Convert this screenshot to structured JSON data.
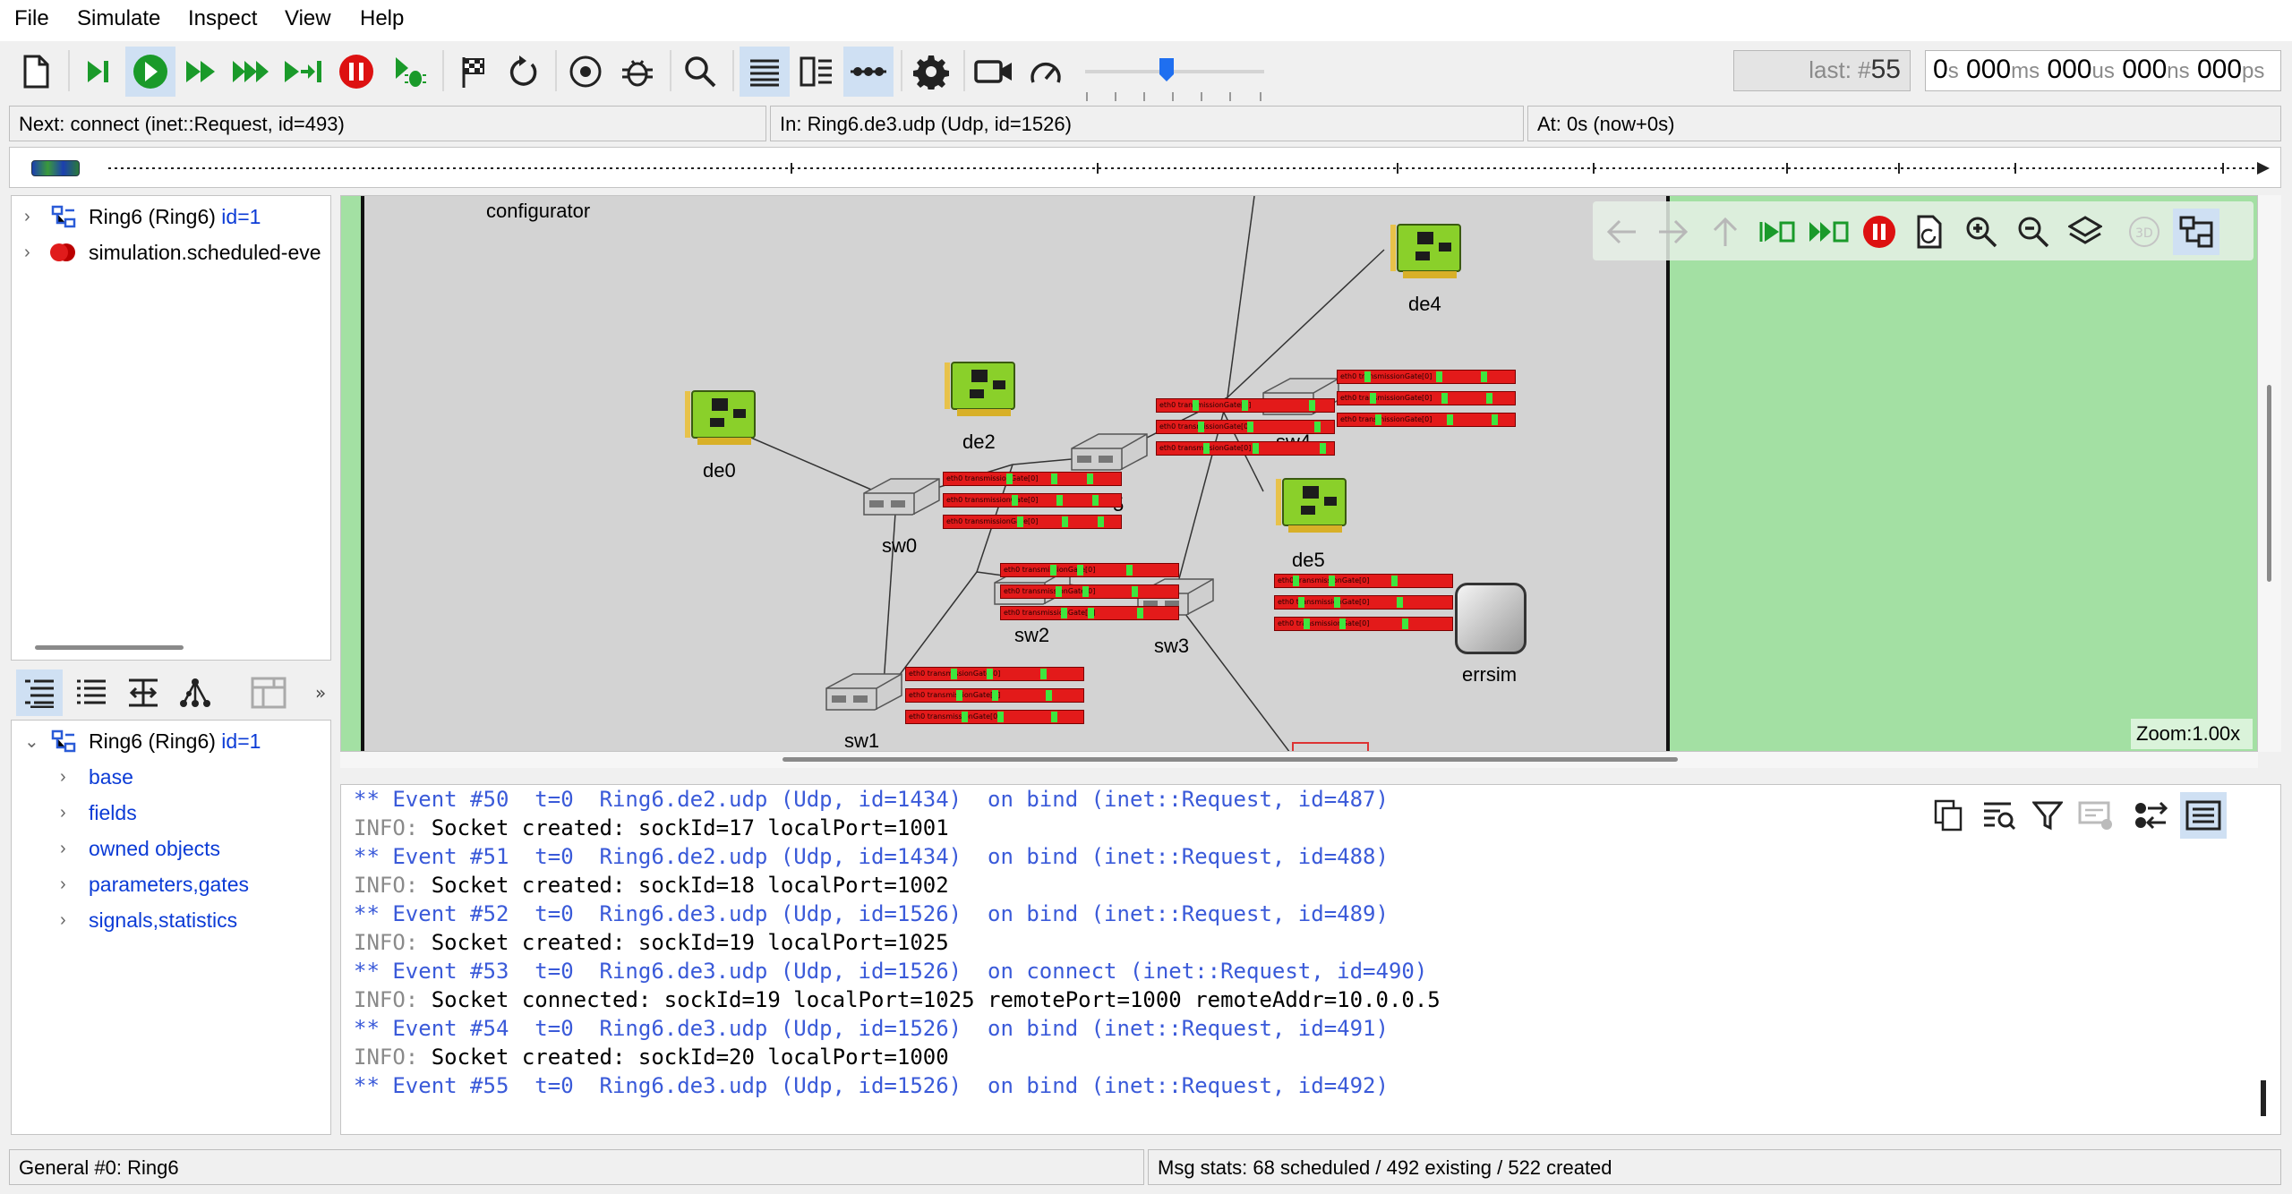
{
  "menu": [
    "File",
    "Simulate",
    "Inspect",
    "View",
    "Help"
  ],
  "toolbar": {
    "buttons": [
      "new-network",
      "step",
      "run",
      "fast-run",
      "express-run",
      "run-until",
      "stop",
      "debug-next-event",
      "set-cutoff",
      "rebuild-network",
      "record-video",
      "speed"
    ],
    "last_event_prefix": "last: #",
    "last_event": "55",
    "simtime": {
      "s": "0",
      "s_u": "s",
      "ms": "000",
      "ms_u": "ms",
      "us": "000",
      "us_u": "us",
      "ns": "000",
      "ns_u": "ns",
      "ps": "000",
      "ps_u": "ps"
    },
    "speed_level": 0.45
  },
  "status": {
    "next": "Next: connect (inet::Request, id=493)",
    "in": "In: Ring6.de3.udp (Udp, id=1526)",
    "at": "At: 0s (now+0s)"
  },
  "object_tree": [
    {
      "name": "Ring6 (Ring6)",
      "id": "id=1",
      "icon": "network-icon"
    },
    {
      "name": "simulation.scheduled-eve",
      "id": "",
      "icon": "event-queue-icon"
    }
  ],
  "inspector_tabs": [
    "grouped-view",
    "flat-view",
    "inheritance-view",
    "children-view",
    "layout-view"
  ],
  "props_tree": {
    "root": {
      "name": "Ring6 (Ring6)",
      "id": "id=1"
    },
    "children": [
      "base",
      "fields",
      "owned objects",
      "parameters,gates",
      "signals,statistics"
    ]
  },
  "canvas": {
    "configurator": "configurator",
    "nodes": {
      "de0": "de0",
      "de2": "de2",
      "de4": "de4",
      "de5": "de5",
      "sw0": "sw0",
      "sw1": "sw1",
      "sw2": "sw2",
      "sw3": "sw3",
      "sw4": "sw4",
      "sw5": "5",
      "errsim": "errsim"
    },
    "queue_label": "eth0 transmissionGate[0]",
    "zoom": "Zoom:1.00x"
  },
  "log": [
    {
      "type": "event",
      "text": "** Event #50  t=0  Ring6.de2.udp (Udp, id=1434)  on bind (inet::Request, id=487)"
    },
    {
      "type": "info",
      "prefix": "INFO: ",
      "text": "Socket created: sockId=17 localPort=1001"
    },
    {
      "type": "event",
      "text": "** Event #51  t=0  Ring6.de2.udp (Udp, id=1434)  on bind (inet::Request, id=488)"
    },
    {
      "type": "info",
      "prefix": "INFO: ",
      "text": "Socket created: sockId=18 localPort=1002"
    },
    {
      "type": "event",
      "text": "** Event #52  t=0  Ring6.de3.udp (Udp, id=1526)  on bind (inet::Request, id=489)"
    },
    {
      "type": "info",
      "prefix": "INFO: ",
      "text": "Socket created: sockId=19 localPort=1025"
    },
    {
      "type": "event",
      "text": "** Event #53  t=0  Ring6.de3.udp (Udp, id=1526)  on connect (inet::Request, id=490)"
    },
    {
      "type": "info",
      "prefix": "INFO: ",
      "text": "Socket connected: sockId=19 localPort=1025 remotePort=1000 remoteAddr=10.0.0.5"
    },
    {
      "type": "event",
      "text": "** Event #54  t=0  Ring6.de3.udp (Udp, id=1526)  on bind (inet::Request, id=491)"
    },
    {
      "type": "info",
      "prefix": "INFO: ",
      "text": "Socket created: sockId=20 localPort=1000"
    },
    {
      "type": "event",
      "text": "** Event #55  t=0  Ring6.de3.udp (Udp, id=1526)  on bind (inet::Request, id=492)"
    }
  ],
  "bottom_status": {
    "config": "General #0: Ring6",
    "msgstats": "Msg stats: 68 scheduled / 492 existing / 522 created"
  },
  "colors": {
    "accent": "#0b3bd6",
    "run_green": "#1a9a2a",
    "stop_red": "#d11",
    "canvas_bg": "#d3d3d3",
    "side_green": "#a0e0a0"
  }
}
